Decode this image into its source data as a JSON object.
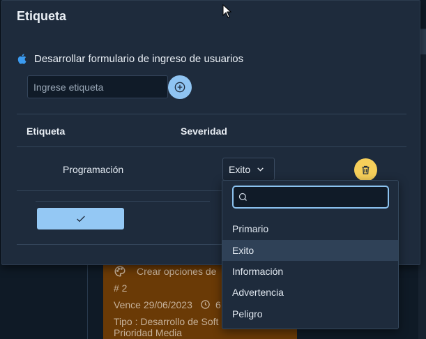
{
  "dialog": {
    "title": "Etiqueta",
    "task_icon": "apple-icon",
    "task_label": "Desarrollar formulario de ingreso de usuarios",
    "tag_input": {
      "placeholder": "Ingrese etiqueta",
      "value": ""
    },
    "add_icon": "plus-circle-icon",
    "table": {
      "headers": [
        "Etiqueta",
        "Severidad"
      ],
      "rows": [
        {
          "label": "Programación",
          "severity": "Exito"
        }
      ]
    },
    "delete_icon": "trash-icon",
    "confirm_icon": "check-icon"
  },
  "dropdown": {
    "filter_value": "",
    "options": [
      "Primario",
      "Exito",
      "Información",
      "Advertencia",
      "Peligro"
    ],
    "selected": "Exito"
  },
  "background_card": {
    "title": "Crear opciones de",
    "number": "# 2",
    "due": "Vence 29/06/2023",
    "time_partial": "6",
    "type": "Tipo : Desarrollo de Soft",
    "priority": "Prioridad Media"
  },
  "colors": {
    "dialog_bg": "#1e2b3c",
    "primary": "#94c8f4",
    "warning": "#f6cf5a",
    "card_bg": "#6a3a06",
    "selected_option": "#2f4157"
  }
}
